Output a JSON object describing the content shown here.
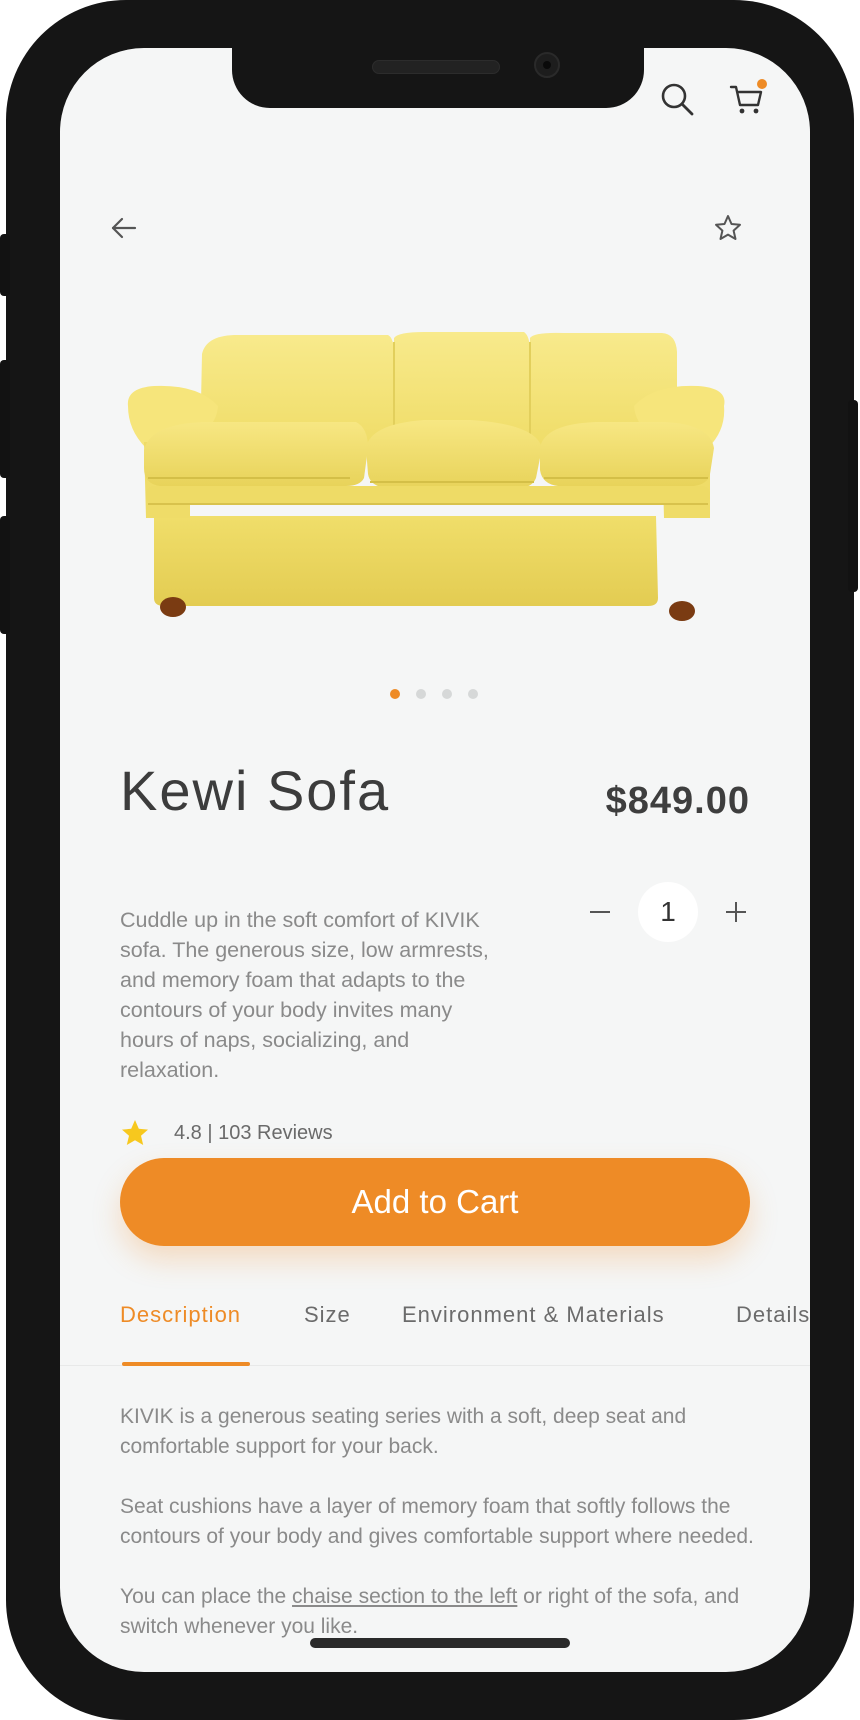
{
  "product": {
    "name": "Kewi Sofa",
    "price": "$849.00",
    "description": "Cuddle up in the soft comfort of KIVIK sofa. The generous size, low armrests, and memory foam that adapts to the contours of your body invites many hours of naps, socializing, and relaxation.",
    "rating_text": "4.8 | 103 Reviews",
    "quantity": "1"
  },
  "cart_button": {
    "label": "Add to Cart"
  },
  "carousel": {
    "count": 4,
    "active_index": 0
  },
  "tabs": [
    {
      "label": "Description",
      "active": true
    },
    {
      "label": "Size",
      "active": false
    },
    {
      "label": "Environment & Materials",
      "active": false
    },
    {
      "label": "Details",
      "active": false
    }
  ],
  "content": {
    "p1": "KIVIK is a generous seating series with a soft, deep seat and comfortable support for your back.",
    "p2": "Seat cushions have a layer of memory foam that softly follows the contours of your body and gives comfortable support where needed.",
    "p3_before": "You can place the ",
    "p3_link": "chaise section to the left",
    "p3_after": " or right of the sofa, and switch whenever you like."
  },
  "icons": {
    "back": "arrow-left-icon",
    "favorite": "star-outline-icon",
    "search": "search-icon",
    "cart": "cart-icon",
    "rating": "star-filled-icon"
  },
  "colors": {
    "accent": "#ee8b26",
    "background": "#f5f6f6",
    "sofa": "#f5e47a",
    "rating_star": "#f7c81e"
  }
}
